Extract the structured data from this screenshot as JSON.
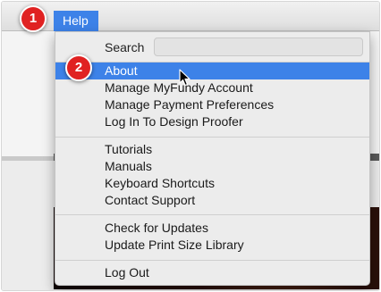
{
  "menubar": {
    "menu_title": "Help"
  },
  "menu": {
    "search": {
      "label": "Search",
      "placeholder": ""
    },
    "groups": [
      [
        "About",
        "Manage MyFundy Account",
        "Manage Payment Preferences",
        "Log In To Design Proofer"
      ],
      [
        "Tutorials",
        "Manuals",
        "Keyboard Shortcuts",
        "Contact Support"
      ],
      [
        "Check for Updates",
        "Update Print Size Library"
      ],
      [
        "Log Out"
      ]
    ],
    "selected_item": "About"
  },
  "callouts": {
    "step1": "1",
    "step2": "2"
  },
  "colors": {
    "highlight": "#3d82e8",
    "callout": "#e02222"
  },
  "icons": {
    "cursor": "arrow-cursor-icon"
  }
}
